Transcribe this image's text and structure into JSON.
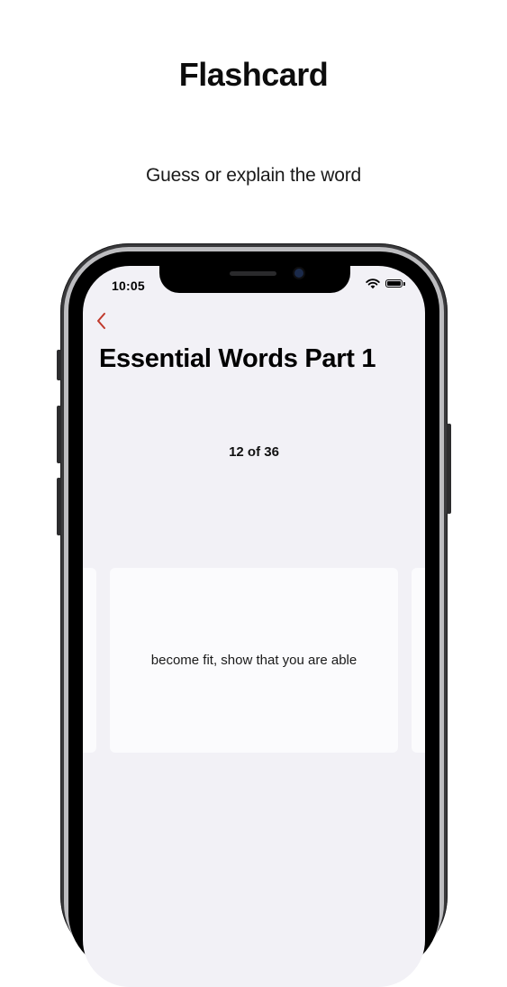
{
  "promo": {
    "title": "Flashcard",
    "subtitle": "Guess or explain the word"
  },
  "status_bar": {
    "time": "10:05",
    "icons": [
      "wifi-icon",
      "battery-icon"
    ]
  },
  "nav": {
    "back_icon": "chevron-left-icon",
    "accent_color": "#c0392b"
  },
  "deck": {
    "title": "Essential Words Part 1",
    "progress": "12 of 36",
    "current_index": 12,
    "total": 36
  },
  "card": {
    "text": "become fit, show that you are able"
  }
}
